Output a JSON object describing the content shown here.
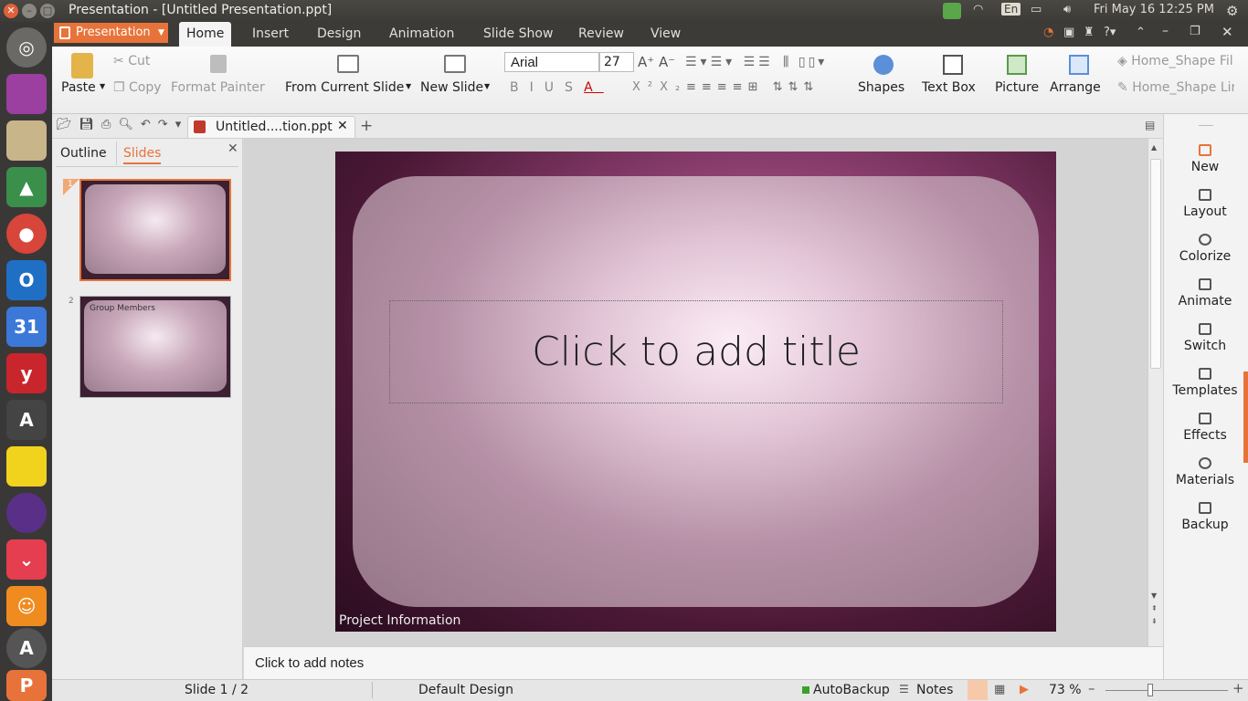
{
  "window": {
    "title": "Presentation - [Untitled Presentation.ppt]"
  },
  "tray": {
    "lang": "En",
    "datetime": "Fri May 16 12:25 PM"
  },
  "app_menu": {
    "label": "Presentation"
  },
  "menu_tabs": [
    "Home",
    "Insert",
    "Design",
    "Animation",
    "Slide Show",
    "Review",
    "View"
  ],
  "ribbon": {
    "paste": "Paste",
    "cut": "Cut",
    "copy": "Copy",
    "format_painter": "Format Painter",
    "from_current_slide": "From Current Slide",
    "new_slide": "New Slide",
    "font_name": "Arial",
    "font_size": "27",
    "shapes": "Shapes",
    "text_box": "Text Box",
    "picture": "Picture",
    "arrange": "Arrange",
    "style_fill": "Home_Shape Fil",
    "style_line": "Home_Shape Lin"
  },
  "doc_tab": {
    "label": "Untitled....tion.ppt"
  },
  "left_pane": {
    "tabs": [
      "Outline",
      "Slides"
    ],
    "slides": [
      {
        "number": "1",
        "caption": ""
      },
      {
        "number": "2",
        "caption": "Group Members"
      }
    ]
  },
  "slide": {
    "title_placeholder": "Click to add title",
    "footer": "Project Information"
  },
  "notes": {
    "placeholder": "Click to add notes"
  },
  "right_pane": {
    "items": [
      "New",
      "Layout",
      "Colorize",
      "Animate",
      "Switch",
      "Templates",
      "Effects",
      "Materials",
      "Backup"
    ]
  },
  "status": {
    "slide_count": "Slide 1 / 2",
    "design": "Default Design",
    "autobackup": "AutoBackup",
    "notes": "Notes",
    "zoom": "73 %"
  },
  "colors": {
    "accent": "#e8733a",
    "titlebar": "#3c3b37"
  }
}
